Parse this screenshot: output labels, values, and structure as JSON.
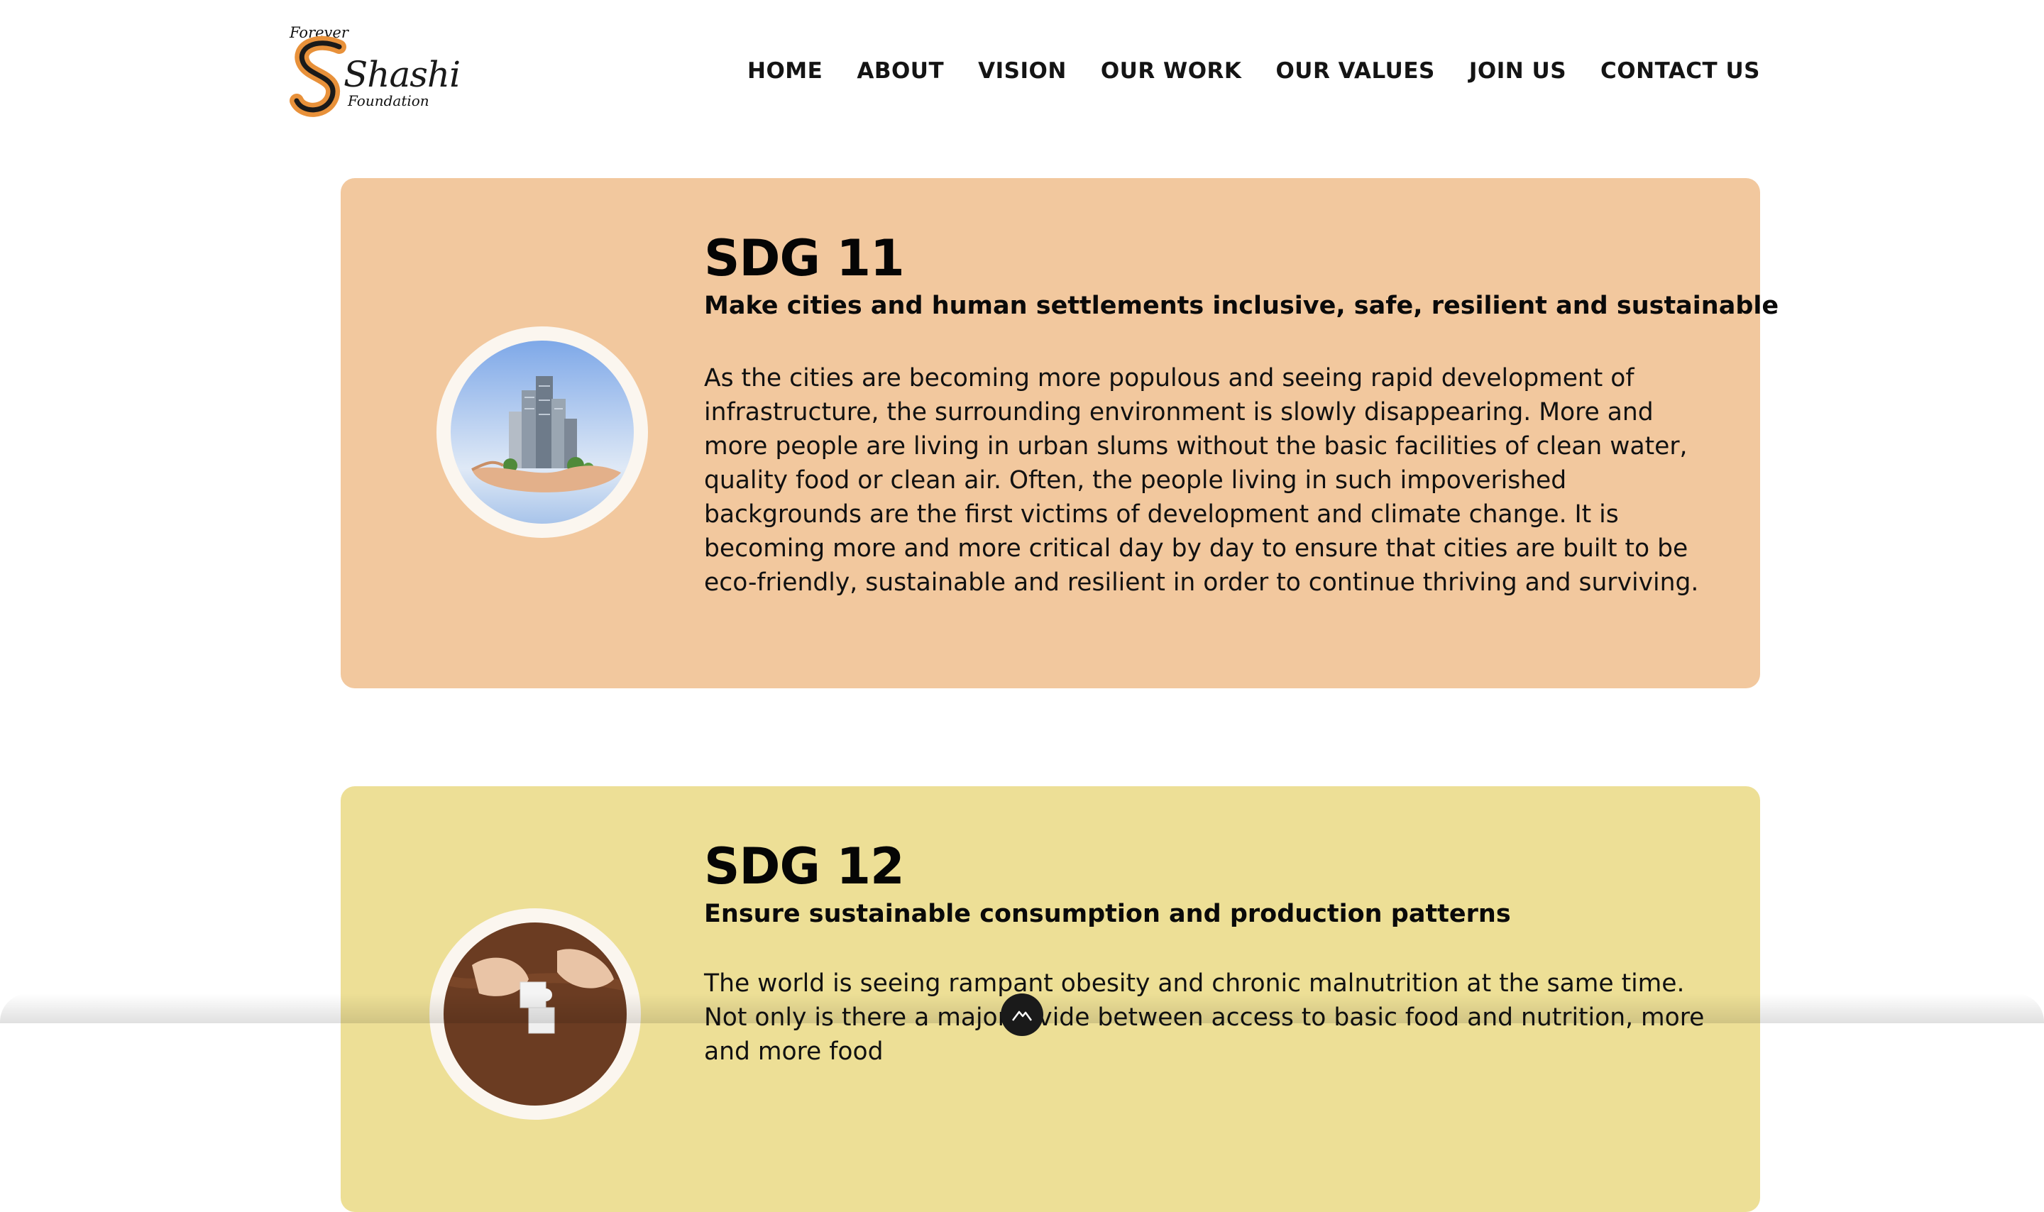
{
  "logo": {
    "top_text": "Forever",
    "name": "Shashi",
    "bottom_text": "Foundation"
  },
  "nav": {
    "items": [
      "HOME",
      "ABOUT",
      "VISION",
      "OUR WORK",
      "OUR VALUES",
      "JOIN US",
      "CONTACT US"
    ]
  },
  "sdg_cards": [
    {
      "title": "SDG 11",
      "subtitle": "Make cities and human settlements inclusive, safe, resilient and sustainable",
      "body": "As the cities are becoming more populous and seeing rapid development of infrastructure, the surrounding environment is slowly disappearing. More and more people are living in urban slums without the basic facilities of clean water, quality food or clean air. Often, the people living in such impoverished backgrounds are the first victims of development and climate change. It is becoming more and more critical day by day to ensure that cities are built to be eco-friendly, sustainable and resilient in order to continue thriving and surviving.",
      "image_icon": "city-in-hand-icon",
      "background": "#f2c89e"
    },
    {
      "title": "SDG 12",
      "subtitle": "Ensure sustainable consumption and production patterns",
      "body": "The world is seeing rampant obesity and chronic malnutrition at the same time. Not only is there a major divide between access to basic food and nutrition, more and more food",
      "image_icon": "puzzle-hands-icon",
      "background": "#eddf96"
    }
  ],
  "colors": {
    "logo_orange": "#e8913a",
    "logo_black": "#1a1a1a",
    "scroll_button": "#1a1a1a"
  },
  "scroll_button": {
    "icon": "mountain-up-icon"
  }
}
